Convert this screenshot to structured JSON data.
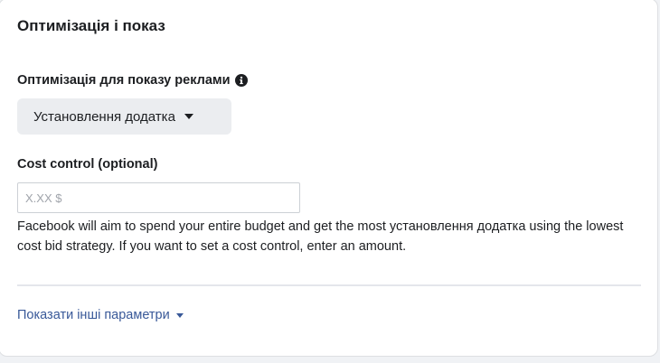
{
  "section": {
    "title": "Оптимізація і показ"
  },
  "optimization": {
    "label": "Оптимізація для показу реклами",
    "info_icon": "info-icon",
    "dropdown_value": "Установлення додатка"
  },
  "cost_control": {
    "label": "Cost control (optional)",
    "placeholder": "X.XX $",
    "value": "",
    "help_text": "Facebook will aim to spend your entire budget and get the most установлення додатка using the lowest cost bid strategy. If you want to set a cost control, enter an amount."
  },
  "more": {
    "link_label": "Показати інші параметри"
  },
  "colors": {
    "link": "#385898",
    "text": "#1c1e21",
    "dropdown_bg": "#ebedf0",
    "page_bg": "#f0f2f5"
  }
}
